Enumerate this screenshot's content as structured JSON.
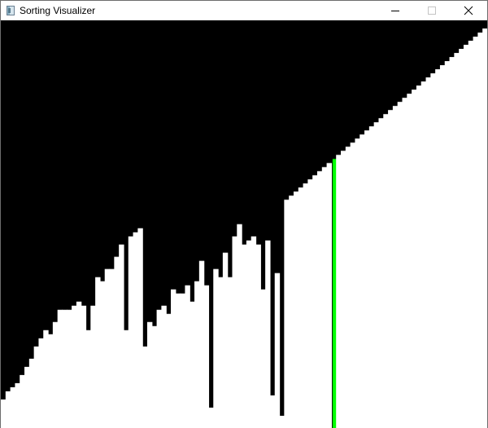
{
  "window": {
    "title": "Sorting Visualizer",
    "icon": "app-window-icon",
    "controls": [
      {
        "name": "minimize",
        "icon": "minimize-icon"
      },
      {
        "name": "maximize",
        "icon": "maximize-icon"
      },
      {
        "name": "close",
        "icon": "close-icon"
      }
    ]
  },
  "colors": {
    "background": "#000000",
    "bar": "#ffffff",
    "active_bar": "#00ff00"
  },
  "chart_data": {
    "type": "bar",
    "values": [
      7,
      9,
      10,
      11,
      13,
      15,
      17,
      20,
      22,
      24,
      23,
      26,
      29,
      29,
      29,
      30,
      31,
      30,
      24,
      30,
      37,
      36,
      39,
      39,
      42,
      45,
      24,
      47,
      48,
      49,
      20,
      26,
      25,
      29,
      30,
      28,
      34,
      33,
      33,
      35,
      31,
      36,
      41,
      35,
      5,
      39,
      37,
      43,
      37,
      47,
      50,
      45,
      46,
      47,
      45,
      34,
      46,
      8,
      38,
      3,
      56,
      57,
      58,
      59,
      60,
      61,
      62,
      63,
      64,
      65,
      66,
      67,
      68,
      69,
      70,
      71,
      72,
      73,
      74,
      75,
      76,
      77,
      78,
      79,
      80,
      81,
      82,
      83,
      84,
      85,
      86,
      87,
      88,
      89,
      90,
      91,
      92,
      93,
      94,
      95,
      96,
      97,
      98
    ],
    "highlight_index": 70,
    "ylim": [
      0,
      100
    ]
  }
}
